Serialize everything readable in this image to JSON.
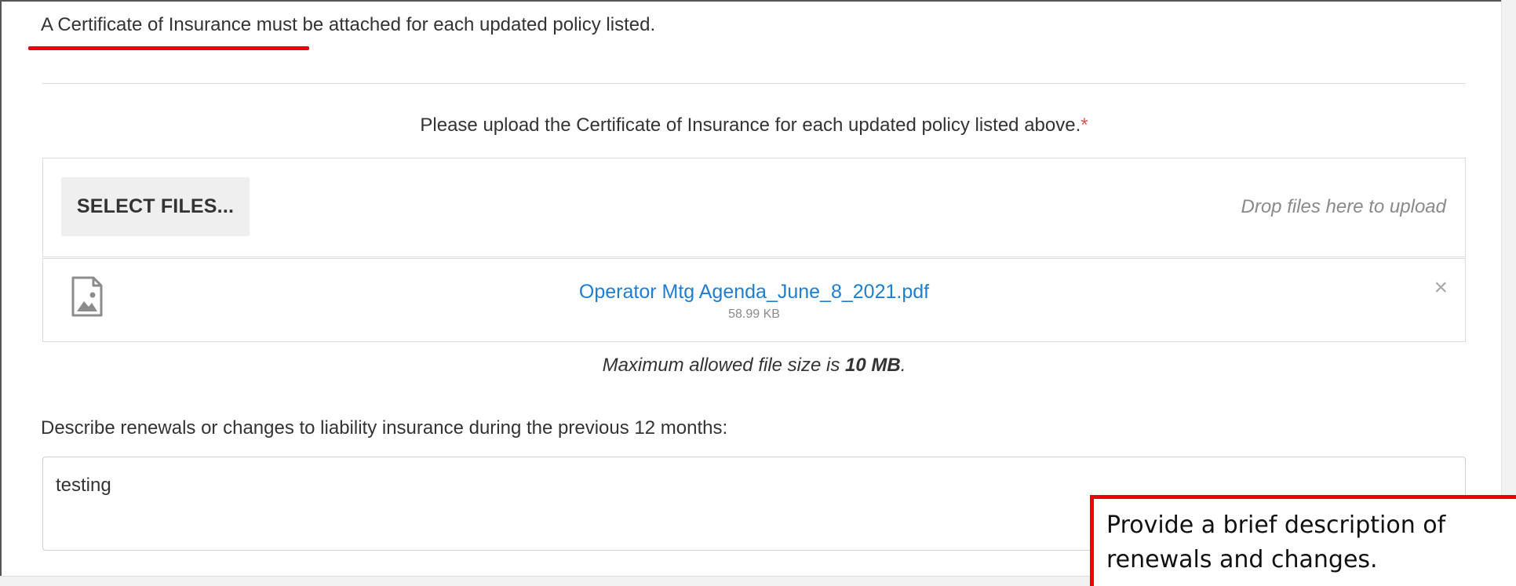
{
  "notice": {
    "text": "A Certificate of Insurance must be attached for each updated policy listed.",
    "underline_color": "#e8000b"
  },
  "upload": {
    "prompt": "Please upload the Certificate of Insurance for each updated policy listed above.",
    "required_marker": "*",
    "select_button_label": "SELECT FILES...",
    "drop_hint": "Drop files here to upload",
    "files": [
      {
        "name": "Operator Mtg Agenda_June_8_2021.pdf",
        "size": "58.99 KB",
        "icon": "image-file-icon",
        "remove_label": "×"
      }
    ],
    "max_size_prefix": "Maximum allowed file size is",
    "max_size_value": "10 MB",
    "max_size_suffix": "."
  },
  "description": {
    "label": "Describe renewals or changes to liability insurance during the previous 12 months:",
    "value": "testing"
  },
  "callout": {
    "text": "Provide a brief description of renewals and changes.",
    "border_color": "#e8000b"
  },
  "colors": {
    "link": "#1e7fd0",
    "required": "#d9534f",
    "muted": "#8a8a8a"
  }
}
